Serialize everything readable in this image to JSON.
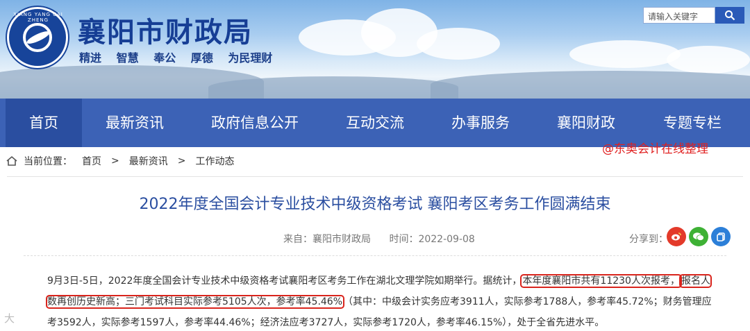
{
  "header": {
    "site_title": "襄阳市财政局",
    "logo_text": "XIANG YANG CAI ZHENG",
    "slogans": [
      "精进",
      "智慧",
      "奉公",
      "厚德",
      "为民理财"
    ],
    "search_placeholder": "请输入关键字"
  },
  "nav": {
    "items": [
      {
        "label": "首页"
      },
      {
        "label": "最新资讯"
      },
      {
        "label": "政府信息公开"
      },
      {
        "label": "互动交流"
      },
      {
        "label": "办事服务"
      },
      {
        "label": "襄阳财政"
      },
      {
        "label": "专题专栏"
      }
    ],
    "watermark": "@东奥会计在线整理"
  },
  "breadcrumb": {
    "prefix": "当前位置：",
    "items": [
      "首页",
      ">",
      "最新资讯",
      ">",
      "工作动态"
    ]
  },
  "article": {
    "title": "2022年度全国会计专业技术中级资格考试 襄阳考区考务工作圆满结束",
    "source": "来自：襄阳市财政局",
    "time": "时间：2022-09-08",
    "share_label": "分享到：",
    "para_a": "9月3日-5日，2022年度全国会计专业技术中级资格考试襄阳考区考务工作在湖北文理学院如期举行。据统计，",
    "para_hl1": "本年度襄阳市共有11230人次报考，",
    "para_hl2": "报名人数再创历史新高；三门考试科目实际参考5105人次，参考率45.46%",
    "para_b": "（其中：中级会计实务应考3911人，实际参考1788人，参考率45.72%；财务管理应考3592人，实际参考1597人，参考率44.46%；经济法应考3727人，实际参考1720人，参考率46.15%），处于全省先进水平。"
  },
  "footer_watermark": "大",
  "colors": {
    "brand": "#3c62b6",
    "title": "#2a4ea0",
    "highlight": "#d9241c"
  }
}
